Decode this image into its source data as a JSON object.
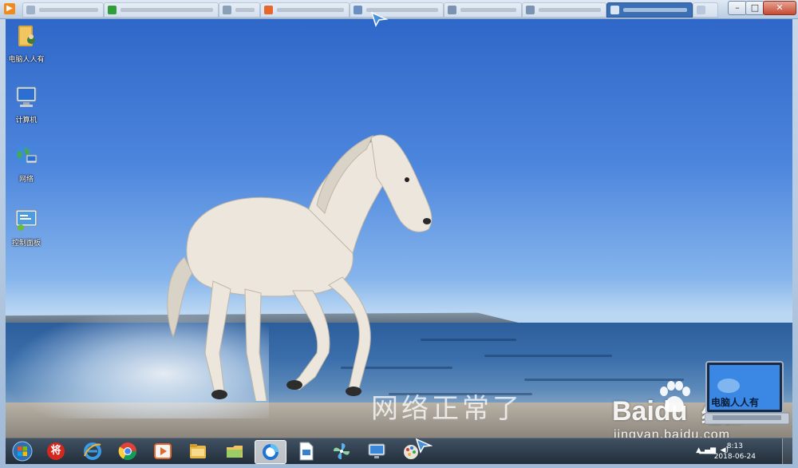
{
  "desktop_icons": [
    {
      "label": "电脑人人有",
      "icon": "folder-user-icon"
    },
    {
      "label": "计算机",
      "icon": "computer-icon"
    },
    {
      "label": "网络",
      "icon": "network-icon"
    },
    {
      "label": "控制面板",
      "icon": "control-panel-icon"
    }
  ],
  "watermark": {
    "caption": "网络正常了",
    "baidu_brand": "Baidu",
    "baidu_jingyan": "经验",
    "url": "jingyan.baidu.com",
    "laptop_text": "电脑人人有"
  },
  "taskbar": {
    "items": [
      {
        "name": "start-button",
        "icon": "windows-orb-icon"
      },
      {
        "name": "taskbar-app-1",
        "icon": "jiang-app-icon",
        "glyph": "将"
      },
      {
        "name": "taskbar-ie",
        "icon": "internet-explorer-icon"
      },
      {
        "name": "taskbar-chrome",
        "icon": "chrome-icon"
      },
      {
        "name": "taskbar-media",
        "icon": "media-player-icon"
      },
      {
        "name": "taskbar-explorer",
        "icon": "file-explorer-icon"
      },
      {
        "name": "taskbar-folder",
        "icon": "folder-icon"
      },
      {
        "name": "taskbar-browser-active",
        "icon": "browser-icon"
      },
      {
        "name": "taskbar-document",
        "icon": "document-icon"
      },
      {
        "name": "taskbar-settings",
        "icon": "pinwheel-icon"
      },
      {
        "name": "taskbar-remote",
        "icon": "remote-desktop-icon"
      },
      {
        "name": "taskbar-paint",
        "icon": "paint-icon"
      }
    ],
    "clock_time": "8:13",
    "clock_date": "2018-06-24"
  },
  "colors": {
    "sky": "#2f67c9",
    "taskbar": "#1e2a36",
    "active_tab": "#3b6fb6"
  }
}
